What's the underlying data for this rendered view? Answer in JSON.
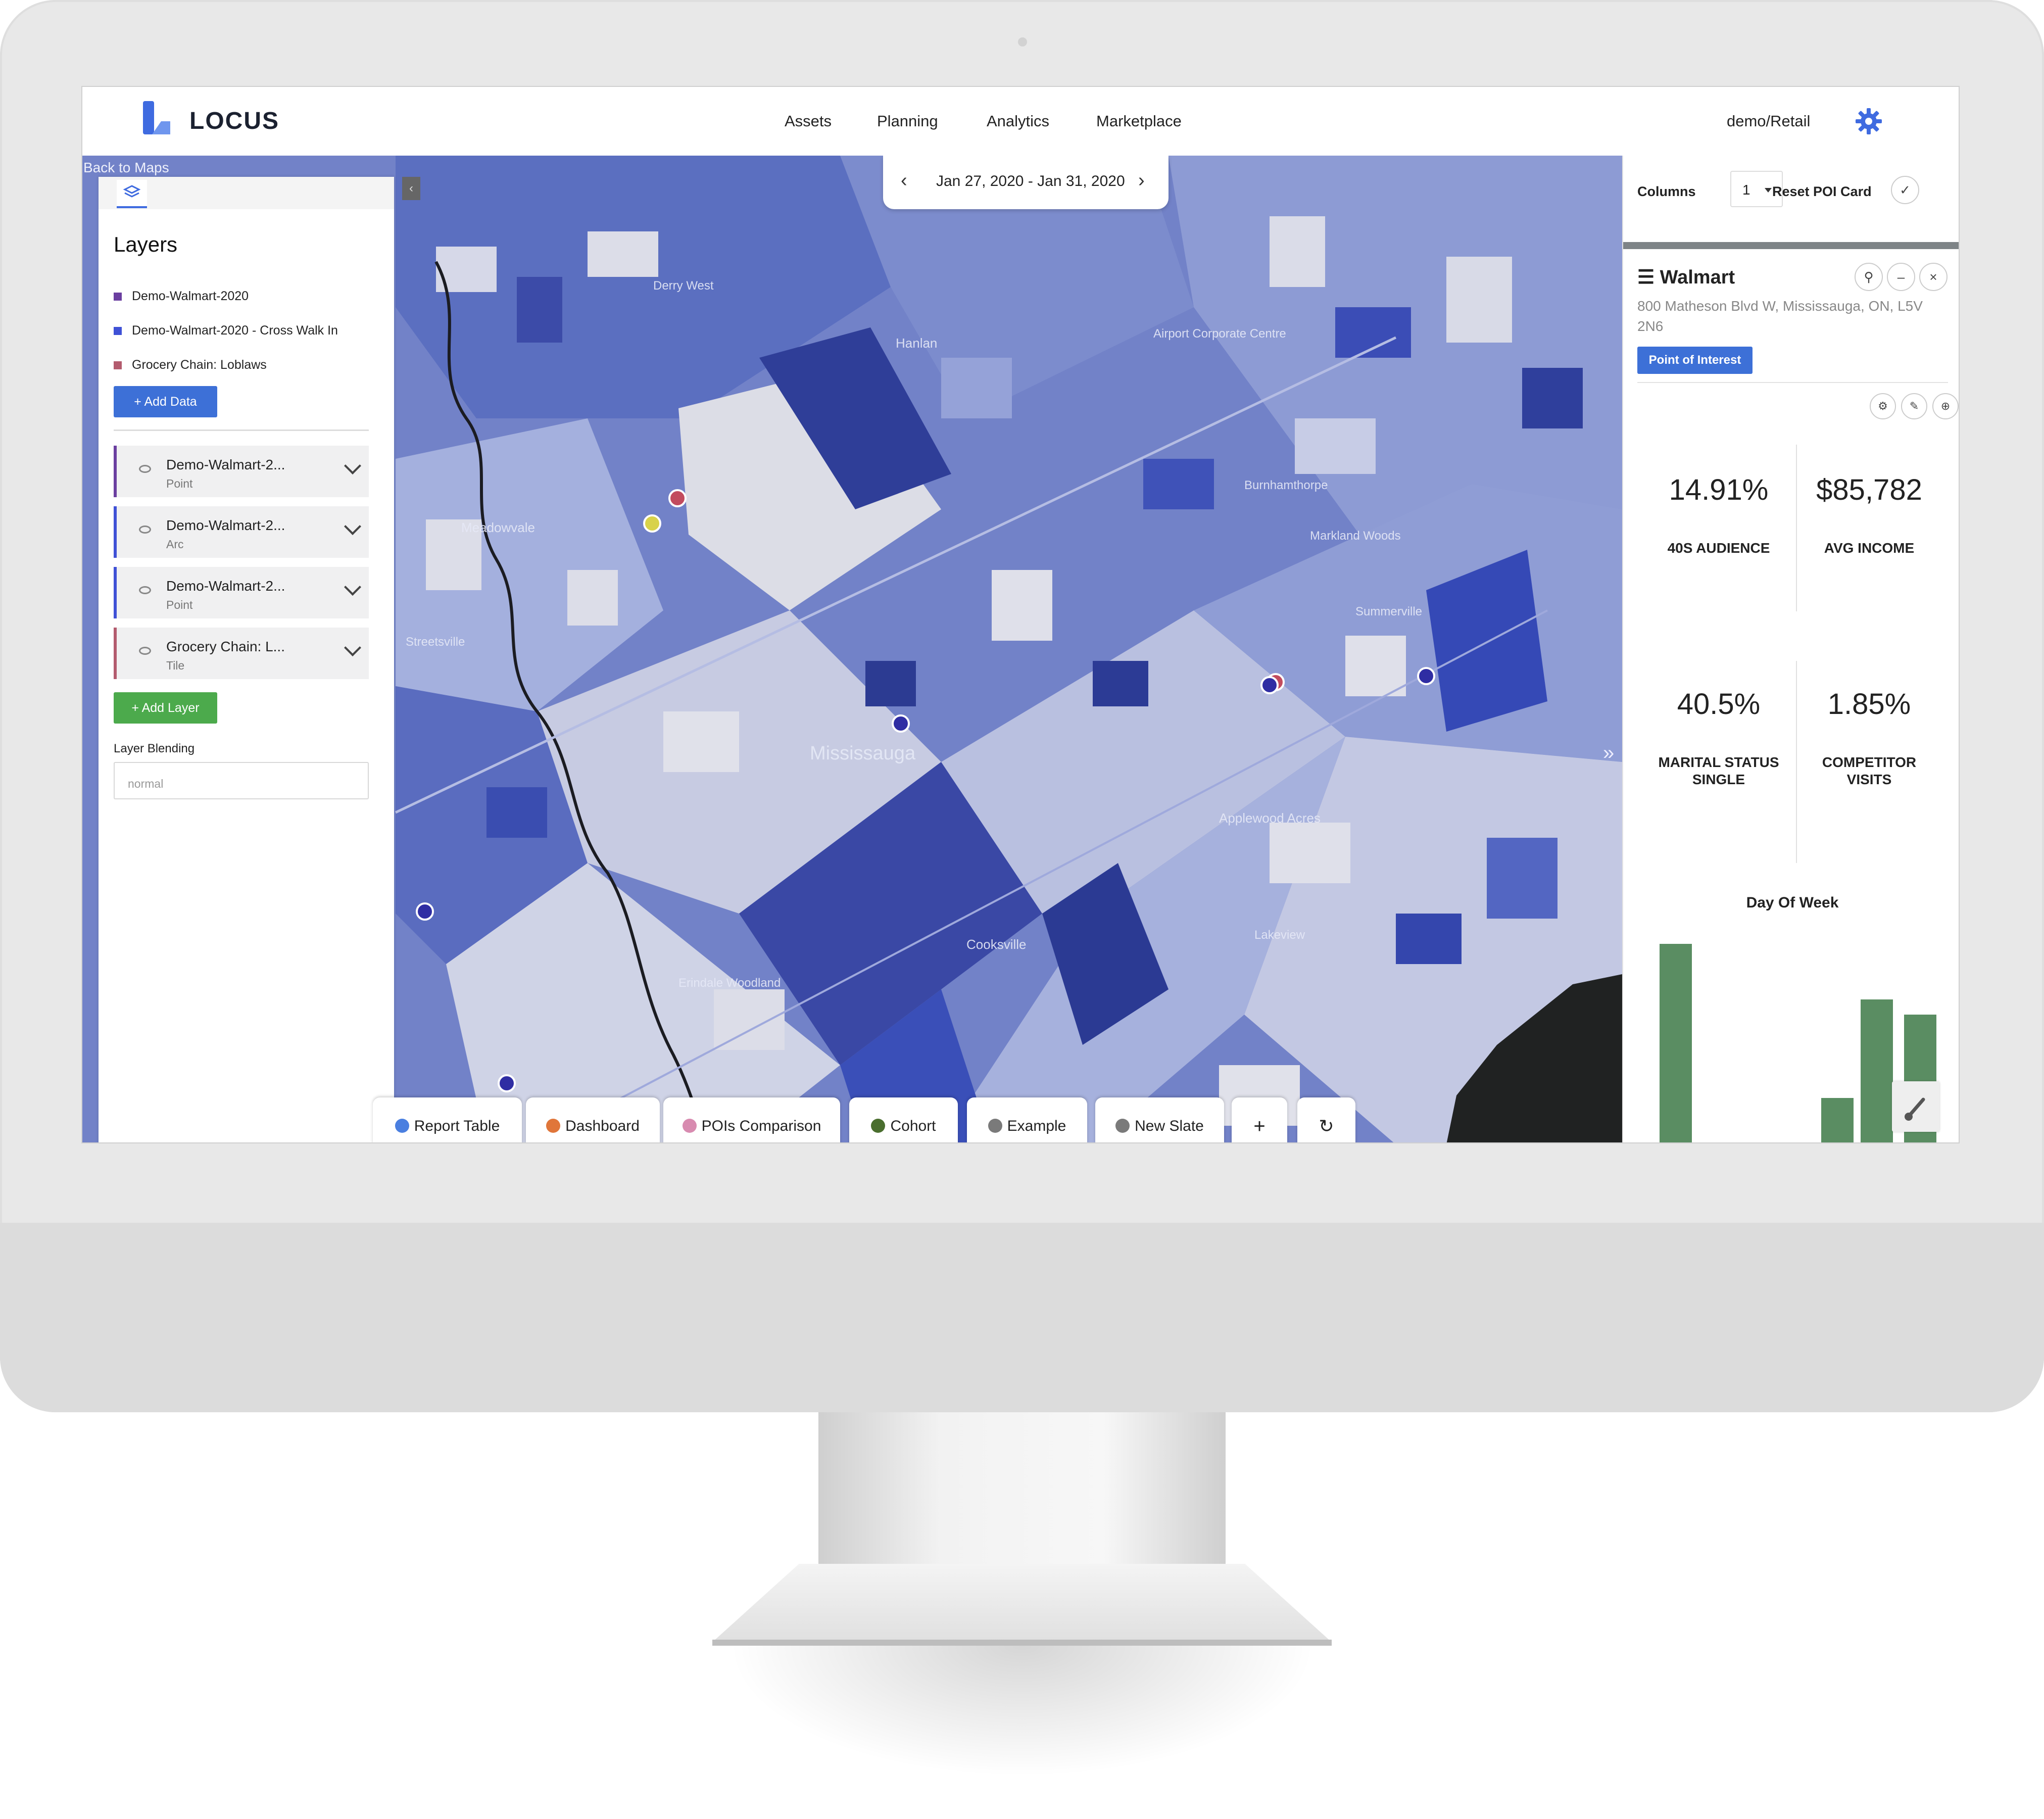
{
  "app": {
    "logo_text": "LOCUS",
    "brand_color": "#3f6be0"
  },
  "nav": {
    "items": [
      "Assets",
      "Planning",
      "Analytics",
      "Marketplace"
    ],
    "user": "demo/Retail",
    "settings_icon": "gear-icon"
  },
  "map": {
    "back_link": "Back to Maps",
    "date_range": "Jan 27, 2020 - Jan 31, 2020",
    "labels": [
      "Mississauga",
      "Cooksville",
      "Applewood Acres",
      "Hanlan",
      "Airport Corporate Centre",
      "Derry West",
      "Meadowvale",
      "Streetsville",
      "Erindale Woodland",
      "Lakeview",
      "Summerville",
      "Markland Woods",
      "Burnhamthorpe"
    ]
  },
  "layers_panel": {
    "title": "Layers",
    "legend": [
      {
        "label": "Demo-Walmart-2020",
        "color": "#6b3fa0"
      },
      {
        "label": "Demo-Walmart-2020 - Cross Walk In",
        "color": "#3f51d6"
      },
      {
        "label": "Grocery Chain: Loblaws",
        "color": "#b35b6e"
      }
    ],
    "add_data_label": "+ Add Data",
    "layers": [
      {
        "name": "Demo-Walmart-2...",
        "type": "Point",
        "color": "#6b3fa0"
      },
      {
        "name": "Demo-Walmart-2...",
        "type": "Arc",
        "color": "#3f51d6"
      },
      {
        "name": "Demo-Walmart-2...",
        "type": "Point",
        "color": "#3f51d6"
      },
      {
        "name": "Grocery Chain: L...",
        "type": "Tile",
        "color": "#b35b6e"
      }
    ],
    "add_layer_label": "+ Add Layer",
    "blending_label": "Layer Blending",
    "blending_value": "normal"
  },
  "bottom_tabs": [
    {
      "label": "Report Table",
      "color": "#4a7fe0"
    },
    {
      "label": "Dashboard",
      "color": "#e0763a"
    },
    {
      "label": "POIs Comparison",
      "color": "#d88bb0"
    },
    {
      "label": "Cohort",
      "color": "#4a6e2e"
    },
    {
      "label": "Example",
      "color": "#7a7a7a"
    },
    {
      "label": "New Slate",
      "color": "#7a7a7a"
    }
  ],
  "right_panel": {
    "columns_label": "Columns",
    "columns_value": "1",
    "reset_label": "Reset POI Card",
    "poi": {
      "name": "Walmart",
      "address": "800 Matheson Blvd W, Mississauga, ON, L5V 2N6",
      "badge": "Point of Interest"
    },
    "metrics": [
      {
        "value": "14.91%",
        "label": "40S AUDIENCE"
      },
      {
        "value": "$85,782",
        "label": "AVG INCOME"
      },
      {
        "value": "40.5%",
        "label": "MARITAL STATUS SINGLE"
      },
      {
        "value": "1.85%",
        "label": "COMPETITOR VISITS"
      }
    ],
    "chart_title": "Day Of Week",
    "bar_color": "#5a8d62"
  }
}
